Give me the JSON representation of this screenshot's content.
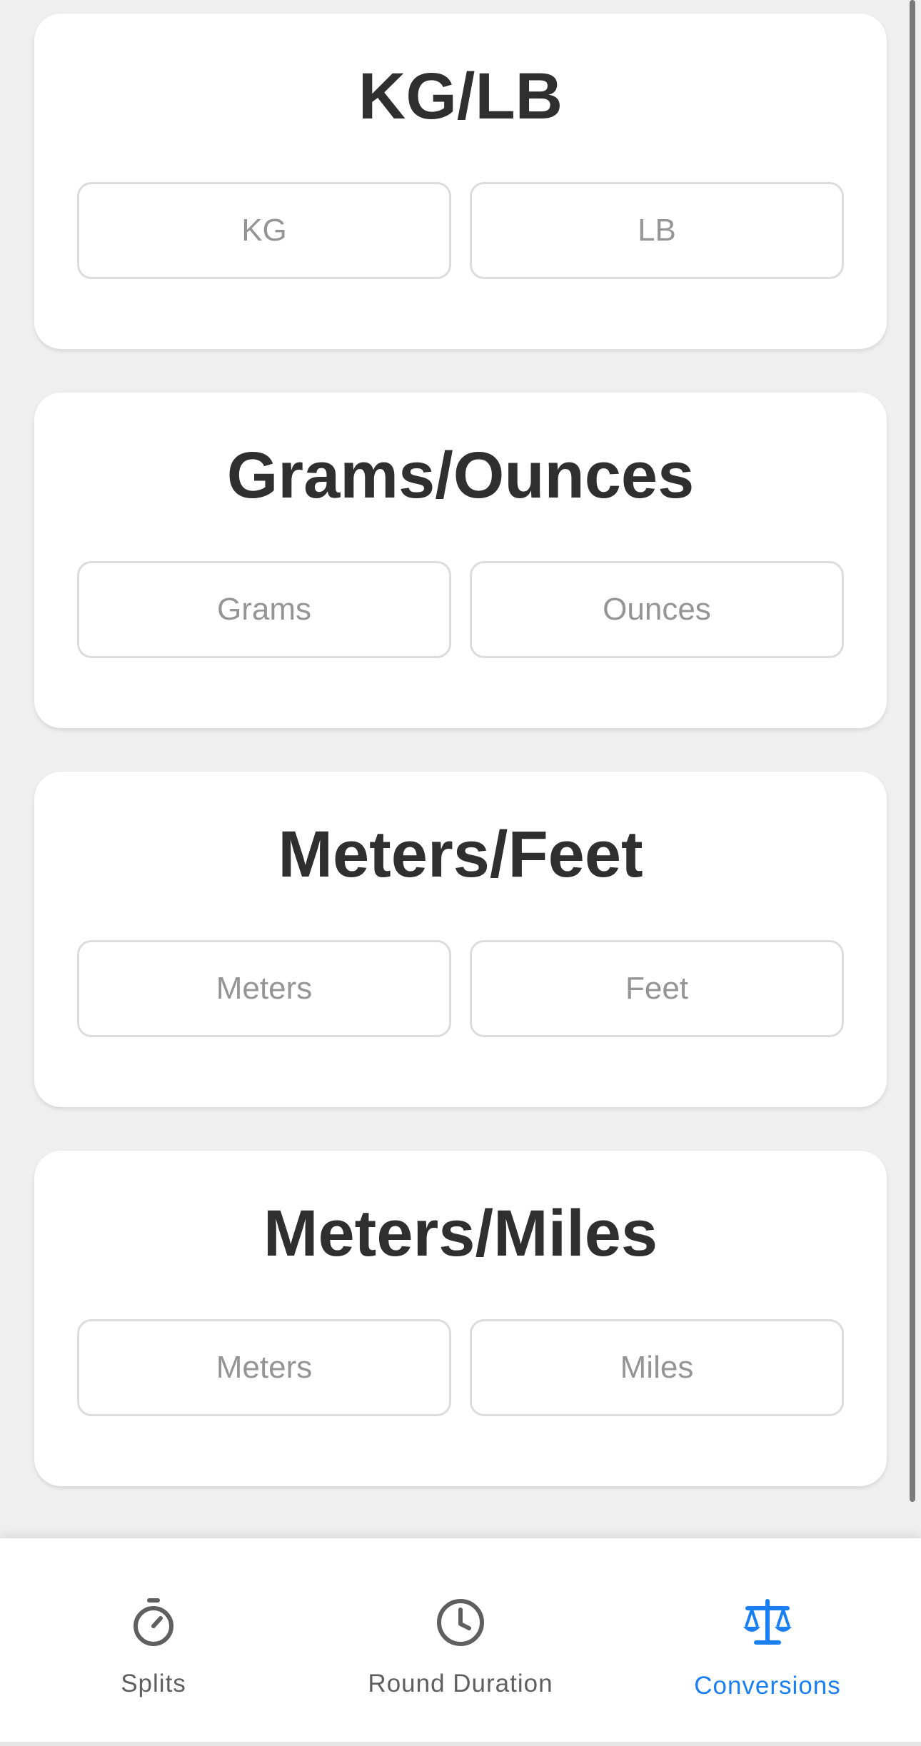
{
  "converters": [
    {
      "title": "KG/LB",
      "fields": [
        {
          "placeholder": "KG",
          "value": ""
        },
        {
          "placeholder": "LB",
          "value": ""
        }
      ]
    },
    {
      "title": "Grams/Ounces",
      "fields": [
        {
          "placeholder": "Grams",
          "value": ""
        },
        {
          "placeholder": "Ounces",
          "value": ""
        }
      ]
    },
    {
      "title": "Meters/Feet",
      "fields": [
        {
          "placeholder": "Meters",
          "value": ""
        },
        {
          "placeholder": "Feet",
          "value": ""
        }
      ]
    },
    {
      "title": "Meters/Miles",
      "fields": [
        {
          "placeholder": "Meters",
          "value": ""
        },
        {
          "placeholder": "Miles",
          "value": ""
        }
      ]
    }
  ],
  "tabbar": {
    "tabs": [
      {
        "label": "Splits",
        "icon": "stopwatch-icon",
        "active": false
      },
      {
        "label": "Round Duration",
        "icon": "clock-icon",
        "active": false
      },
      {
        "label": "Conversions",
        "icon": "scale-icon",
        "active": true
      }
    ]
  },
  "colors": {
    "background": "#efefef",
    "card": "#ffffff",
    "title": "#2f2f2f",
    "placeholder": "#959595",
    "field_border": "#dcdcdc",
    "tab_inactive": "#5f5f5f",
    "tab_active": "#1a7ff3"
  }
}
